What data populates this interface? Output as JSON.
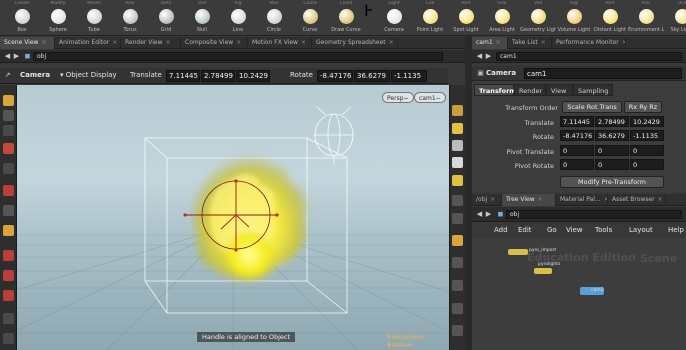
{
  "shelf_tabs_left": [
    "Create",
    "Modify",
    "Model",
    "Poly",
    "Defo",
    "Text",
    "Rig",
    "Mus",
    "Chara",
    "Const",
    "Hair",
    "Guid",
    "Term",
    "Sim"
  ],
  "shelf_tools_left": [
    {
      "label": "Box",
      "color": "#bfbfbf"
    },
    {
      "label": "Sphere",
      "color": "#d6d6d6"
    },
    {
      "label": "Tube",
      "color": "#bdbdbd"
    },
    {
      "label": "Torus",
      "color": "#a8a8a8"
    },
    {
      "label": "Grid",
      "color": "#9c9c9c"
    },
    {
      "label": "Null",
      "color": "#9aa"
    },
    {
      "label": "Line",
      "color": "#c8c8c8"
    },
    {
      "label": "Circle",
      "color": "#bbbbbb"
    },
    {
      "label": "Curve",
      "color": "#c9a83a"
    },
    {
      "label": "Draw Curve",
      "color": "#c9a83a"
    }
  ],
  "shelf_tabs_right": [
    "Light",
    "Coll",
    "Part",
    "Grai",
    "Vell",
    "Rigi",
    "Part",
    "Visc",
    "Oce",
    "Fluid",
    "Pyr",
    "Clot"
  ],
  "shelf_tools_right": [
    {
      "label": "Camera",
      "color": "#d9d9d9"
    },
    {
      "label": "Point Light",
      "color": "#f4d33a"
    },
    {
      "label": "Spot Light",
      "color": "#f4d33a"
    },
    {
      "label": "Area Light",
      "color": "#f4d33a"
    },
    {
      "label": "Geometry Light",
      "color": "#f0c73a"
    },
    {
      "label": "Volume Light",
      "color": "#e8b530"
    },
    {
      "label": "Distant Light",
      "color": "#f4d33a"
    },
    {
      "label": "Environment Light",
      "color": "#f0d050"
    },
    {
      "label": "Sky Light",
      "color": "#e6cf54"
    },
    {
      "label": "GI Light",
      "color": "#e3c14a"
    }
  ],
  "left_tabs": [
    {
      "label": "Scene View",
      "active": true
    },
    {
      "label": "Animation Editor",
      "active": false
    },
    {
      "label": "Render View",
      "active": false
    },
    {
      "label": "Composite View",
      "active": false
    },
    {
      "label": "Motion FX View",
      "active": false
    },
    {
      "label": "Geometry Spreadsheet",
      "active": false
    }
  ],
  "left_path": "obj",
  "op_toolbar": {
    "type": "Camera",
    "object_display": "Object Display",
    "translate_label": "Translate",
    "translate": [
      "7.11445",
      "2.78499",
      "10.2429"
    ],
    "rotate_label": "Rotate",
    "rotate": [
      "-8.47176",
      "36.6279",
      "-1.1135"
    ]
  },
  "viewport": {
    "persp": "Persp−",
    "cam": "cam1−",
    "handle_message": "Handle is aligned to Object",
    "watermark": "Education Edition"
  },
  "right_top_tabs": [
    {
      "label": "cam1",
      "active": true
    },
    {
      "label": "Take List",
      "active": false
    },
    {
      "label": "Performance Monitor",
      "active": false
    }
  ],
  "right_path": "cam1",
  "param": {
    "node_type": "Camera",
    "node_name": "cam1",
    "tabs": [
      {
        "label": "Transform",
        "active": true
      },
      {
        "label": "Render",
        "active": false
      },
      {
        "label": "View",
        "active": false
      },
      {
        "label": "Sampling",
        "active": false
      }
    ],
    "transform_order_label": "Transform Order",
    "transform_order": "Scale Rot Trans",
    "rotate_order": "Rx Ry Rz",
    "translate_label": "Translate",
    "translate": [
      "7.11445",
      "2.78499",
      "10.2429"
    ],
    "rotate_label": "Rotate",
    "rotate": [
      "-8.47176",
      "36.6279",
      "-1.1135"
    ],
    "pivot_translate_label": "Pivot Translate",
    "pivot_translate": [
      "0",
      "0",
      "0"
    ],
    "pivot_rotate_label": "Pivot Rotate",
    "pivot_rotate": [
      "0",
      "0",
      "0"
    ],
    "modify_button": "Modify Pre-Transform"
  },
  "net_tabs": [
    {
      "label": "/obj",
      "active": false
    },
    {
      "label": "Tree View",
      "active": true
    },
    {
      "label": "Material Pal...",
      "active": false
    },
    {
      "label": "Asset Browser",
      "active": false
    }
  ],
  "net_path": "obj",
  "net_menu": [
    "Add",
    "Edit",
    "Go",
    "View",
    "Tools",
    "Layout",
    "Help"
  ],
  "net_watermark": [
    "Education Edition",
    "Scene"
  ],
  "nodes": [
    {
      "label": "pyro_import",
      "color": "#d4c04a"
    },
    {
      "label": "pyrolights",
      "color": "#d4c04a"
    },
    {
      "label": "cam1",
      "color": "#5aa0d6"
    }
  ]
}
